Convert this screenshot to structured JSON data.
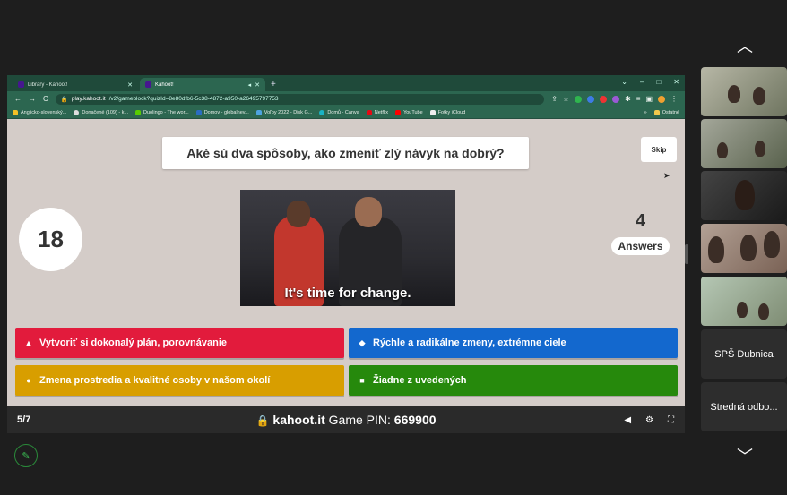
{
  "browser": {
    "tabs": [
      {
        "label": "Library - Kahoot!"
      },
      {
        "label": "Kahoot!"
      }
    ],
    "url": "play.kahoot.it",
    "url_path": "/v2/gameblock?quizId=8e80dfb6-5c38-4872-a950-a26495797753",
    "bookmarks": [
      "Anglicko-slovenský...",
      "Donačené (109) - k...",
      "Duolingo - The wor...",
      "Domov - globalnev...",
      "Voľby 2022 - Disk G...",
      "Domů - Canva",
      "Netflix",
      "YouTube",
      "Fotky iCloud"
    ],
    "bookmarks_more": "»",
    "other_bookmarks": "Ostatné"
  },
  "game": {
    "question": "Aké sú dva spôsoby, ako zmeniť zlý návyk na dobrý?",
    "skip_label": "Skip",
    "timer": "18",
    "answers_count": "4",
    "answers_label": "Answers",
    "media_caption": "It's time for change.",
    "options": [
      {
        "shape": "▲",
        "label": "Vytvoriť si dokonalý plán, porovnávanie",
        "color": "#e21b3c"
      },
      {
        "shape": "◆",
        "label": "Rýchle a radikálne zmeny, extrémne ciele",
        "color": "#1368ce"
      },
      {
        "shape": "●",
        "label": "Zmena prostredia a kvalitné osoby v našom okolí",
        "color": "#d89e00"
      },
      {
        "shape": "■",
        "label": "Žiadne z uvedených",
        "color": "#26890c"
      }
    ],
    "progress": "5/7",
    "site": "kahoot.it",
    "pin_label": "Game PIN:",
    "pin": "669900"
  },
  "meet": {
    "participants": [
      {
        "name": "SPŠ Dubnica"
      },
      {
        "name": "Stredná odbo..."
      }
    ]
  }
}
